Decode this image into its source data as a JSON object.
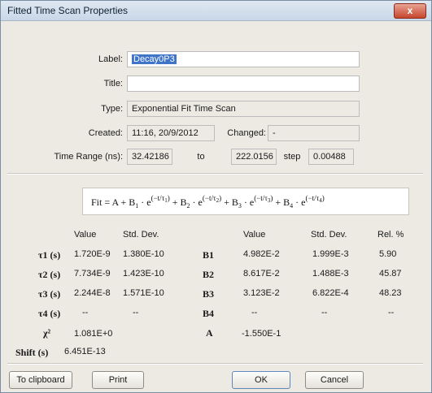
{
  "window": {
    "title": "Fitted Time Scan Properties",
    "close_glyph": "x"
  },
  "fields": {
    "label_caption": "Label:",
    "label_value": "Decay0P3",
    "title_caption": "Title:",
    "title_value": "",
    "type_caption": "Type:",
    "type_value": "Exponential Fit Time Scan",
    "created_caption": "Created:",
    "created_value": "11:16, 20/9/2012",
    "changed_caption": "Changed:",
    "changed_value": "-",
    "range_caption": "Time Range (ns):",
    "range_from": "32.42186",
    "to_caption": "to",
    "range_to": "222.0156",
    "step_caption": "step",
    "step_value": "0.00488"
  },
  "formula": {
    "lhs": "Fit = A + B",
    "text": "Fit = A + B1·e^(-t/τ1) + B2·e^(-t/τ2) + B3·e^(-t/τ3) + B4·e^(-t/τ4)"
  },
  "left_table": {
    "headers": [
      "Value",
      "Std. Dev."
    ],
    "rows": [
      {
        "label": "τ1 (s)",
        "value": "1.720E-9",
        "std": "1.380E-10"
      },
      {
        "label": "τ2 (s)",
        "value": "7.734E-9",
        "std": "1.423E-10"
      },
      {
        "label": "τ3 (s)",
        "value": "2.244E-8",
        "std": "1.571E-10"
      },
      {
        "label": "τ4 (s)",
        "value": "--",
        "std": "--"
      },
      {
        "label": "χ²",
        "value": "1.081E+0",
        "std": ""
      },
      {
        "label": "Shift (s)",
        "value": "6.451E-13",
        "std": ""
      }
    ]
  },
  "right_table": {
    "headers": [
      "Value",
      "Std. Dev.",
      "Rel. %"
    ],
    "rows": [
      {
        "label": "B1",
        "value": "4.982E-2",
        "std": "1.999E-3",
        "rel": "5.90"
      },
      {
        "label": "B2",
        "value": "8.617E-2",
        "std": "1.488E-3",
        "rel": "45.87"
      },
      {
        "label": "B3",
        "value": "3.123E-2",
        "std": "6.822E-4",
        "rel": "48.23"
      },
      {
        "label": "B4",
        "value": "--",
        "std": "--",
        "rel": "--"
      },
      {
        "label": "A",
        "value": "-1.550E-1",
        "std": "",
        "rel": ""
      }
    ]
  },
  "buttons": {
    "clipboard": "To clipboard",
    "print": "Print",
    "ok": "OK",
    "cancel": "Cancel"
  }
}
